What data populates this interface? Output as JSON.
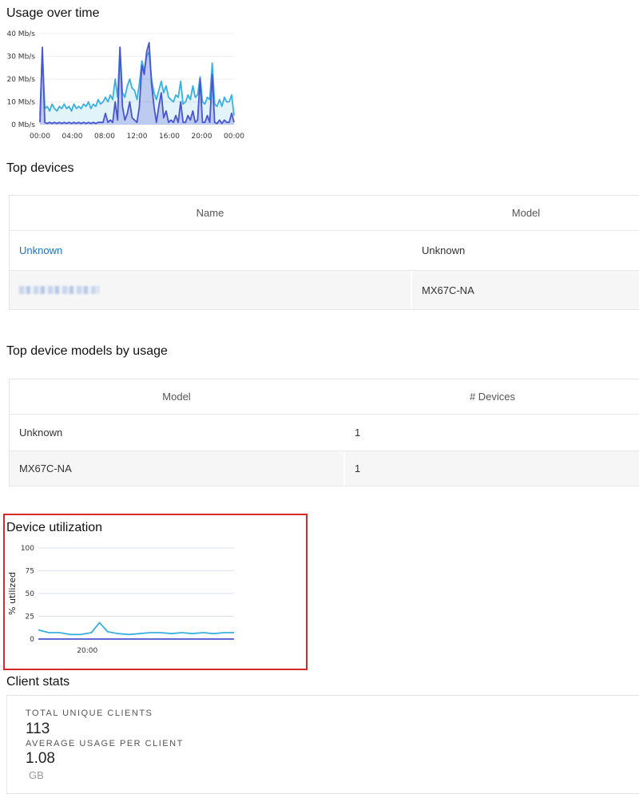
{
  "usage": {
    "title": "Usage over time",
    "chart_data": {
      "type": "area",
      "title": "",
      "ylabel": "",
      "ylim": [
        0,
        40
      ],
      "y_ticks": [
        "0 Mb/s",
        "10 Mb/s",
        "20 Mb/s",
        "30 Mb/s",
        "40 Mb/s"
      ],
      "x_ticks": [
        "00:00",
        "04:00",
        "08:00",
        "12:00",
        "16:00",
        "20:00",
        "00:00"
      ],
      "x_range": [
        0,
        24
      ],
      "series": [
        {
          "color": "#3ab0e0",
          "x": [
            0,
            0.3,
            0.6,
            0.9,
            1.2,
            1.5,
            1.8,
            2.1,
            2.4,
            2.7,
            3,
            3.3,
            3.6,
            3.9,
            4.2,
            4.5,
            4.8,
            5.1,
            5.4,
            5.7,
            6,
            6.3,
            6.6,
            6.9,
            7.2,
            7.5,
            7.8,
            8.1,
            8.4,
            8.7,
            9,
            9.3,
            9.6,
            9.9,
            10.2,
            10.5,
            10.8,
            11.1,
            11.4,
            11.7,
            12,
            12.3,
            12.6,
            12.9,
            13.2,
            13.5,
            13.8,
            14.1,
            14.4,
            14.7,
            15,
            15.3,
            15.6,
            15.9,
            16.2,
            16.5,
            16.8,
            17.1,
            17.4,
            17.7,
            18,
            18.3,
            18.6,
            18.9,
            19.2,
            19.5,
            19.8,
            20.1,
            20.4,
            20.7,
            21,
            21.3,
            21.6,
            21.9,
            22.2,
            22.5,
            22.8,
            23.1,
            23.4,
            23.7,
            24
          ],
          "values": [
            4,
            32,
            7,
            8,
            6,
            9,
            7,
            6,
            8,
            7,
            9,
            7,
            8,
            6,
            9,
            7,
            8,
            7,
            9,
            8,
            10,
            7,
            9,
            8,
            11,
            9,
            10,
            12,
            10,
            13,
            11,
            20,
            12,
            34,
            14,
            12,
            17,
            20,
            16,
            15,
            11,
            18,
            28,
            24,
            30,
            32,
            20,
            14,
            11,
            15,
            19,
            14,
            17,
            12,
            11,
            10,
            13,
            12,
            19,
            9,
            10,
            13,
            11,
            17,
            12,
            13,
            21,
            10,
            9,
            12,
            11,
            27,
            9,
            8,
            11,
            8,
            12,
            10,
            10,
            13,
            4
          ]
        },
        {
          "color": "#4a55d0",
          "x": [
            0,
            0.3,
            0.6,
            0.9,
            1.2,
            1.5,
            1.8,
            2.1,
            2.4,
            2.7,
            3,
            3.3,
            3.6,
            3.9,
            4.2,
            4.5,
            4.8,
            5.1,
            5.4,
            5.7,
            6,
            6.3,
            6.6,
            6.9,
            7.2,
            7.5,
            7.8,
            8.1,
            8.4,
            8.7,
            9,
            9.3,
            9.6,
            9.9,
            10.2,
            10.5,
            10.8,
            11.1,
            11.4,
            11.7,
            12,
            12.3,
            12.6,
            12.9,
            13.2,
            13.5,
            13.8,
            14.1,
            14.4,
            14.7,
            15,
            15.3,
            15.6,
            15.9,
            16.2,
            16.5,
            16.8,
            17.1,
            17.4,
            17.7,
            18,
            18.3,
            18.6,
            18.9,
            19.2,
            19.5,
            19.8,
            20.1,
            20.4,
            20.7,
            21,
            21.3,
            21.6,
            21.9,
            22.2,
            22.5,
            22.8,
            23.1,
            23.4,
            23.7,
            24
          ],
          "values": [
            1,
            34,
            1,
            0.5,
            1,
            0.5,
            1,
            0.5,
            1,
            0.5,
            1,
            0.5,
            1,
            0.5,
            1,
            0.5,
            1,
            0.5,
            1,
            0.5,
            1,
            0.5,
            1,
            0.5,
            1,
            1,
            1,
            5,
            1,
            2,
            1,
            10,
            2,
            34,
            8,
            2,
            5,
            10,
            3,
            2,
            1,
            8,
            26,
            22,
            32,
            36,
            18,
            8,
            1,
            8,
            14,
            3,
            6,
            1,
            2,
            1,
            4,
            1,
            10,
            1,
            1,
            4,
            2,
            6,
            1,
            2,
            20,
            1,
            1,
            4,
            1,
            22,
            1,
            0.5,
            2,
            0.5,
            2,
            1,
            1,
            5,
            1
          ]
        }
      ]
    }
  },
  "top_devices": {
    "title": "Top devices",
    "columns": [
      "Name",
      "Model"
    ],
    "rows": [
      {
        "name": "Unknown",
        "model": "Unknown"
      },
      {
        "name": "",
        "model": "MX67C-NA"
      }
    ]
  },
  "top_models": {
    "title": "Top device models by usage",
    "columns": [
      "Model",
      "# Devices"
    ],
    "rows": [
      {
        "model": "Unknown",
        "devices": "1"
      },
      {
        "model": "MX67C-NA",
        "devices": "1"
      }
    ]
  },
  "utilization": {
    "title": "Device utilization",
    "chart_data": {
      "type": "line",
      "title": "",
      "ylabel": "% utilized",
      "ylim": [
        0,
        100
      ],
      "y_ticks": [
        "0",
        "25",
        "50",
        "75",
        "100"
      ],
      "x_ticks": [
        "20:00"
      ],
      "x_range": [
        0,
        24
      ],
      "x_tick_positions": [
        6
      ],
      "series": [
        {
          "color": "#3ab0e0",
          "x": [
            0,
            1.3,
            2.6,
            3.9,
            5.2,
            6.5,
            7.5,
            8.5,
            9.8,
            11.1,
            12.4,
            13.7,
            15,
            16.3,
            17.6,
            18.9,
            20.2,
            21.5,
            22.8,
            24
          ],
          "values": [
            10,
            7,
            7,
            5,
            5,
            7,
            18,
            8,
            6,
            5,
            6,
            7,
            7,
            6,
            7,
            6,
            7,
            6,
            7,
            7
          ]
        },
        {
          "color": "#4a55d0",
          "x": [
            0,
            24
          ],
          "values": [
            0,
            0
          ]
        }
      ]
    }
  },
  "client_stats": {
    "title": "Client stats",
    "total_label": "TOTAL UNIQUE CLIENTS",
    "total_value": "113",
    "avg_label": "AVERAGE USAGE PER CLIENT",
    "avg_value": "1.08",
    "avg_unit": "GB"
  }
}
